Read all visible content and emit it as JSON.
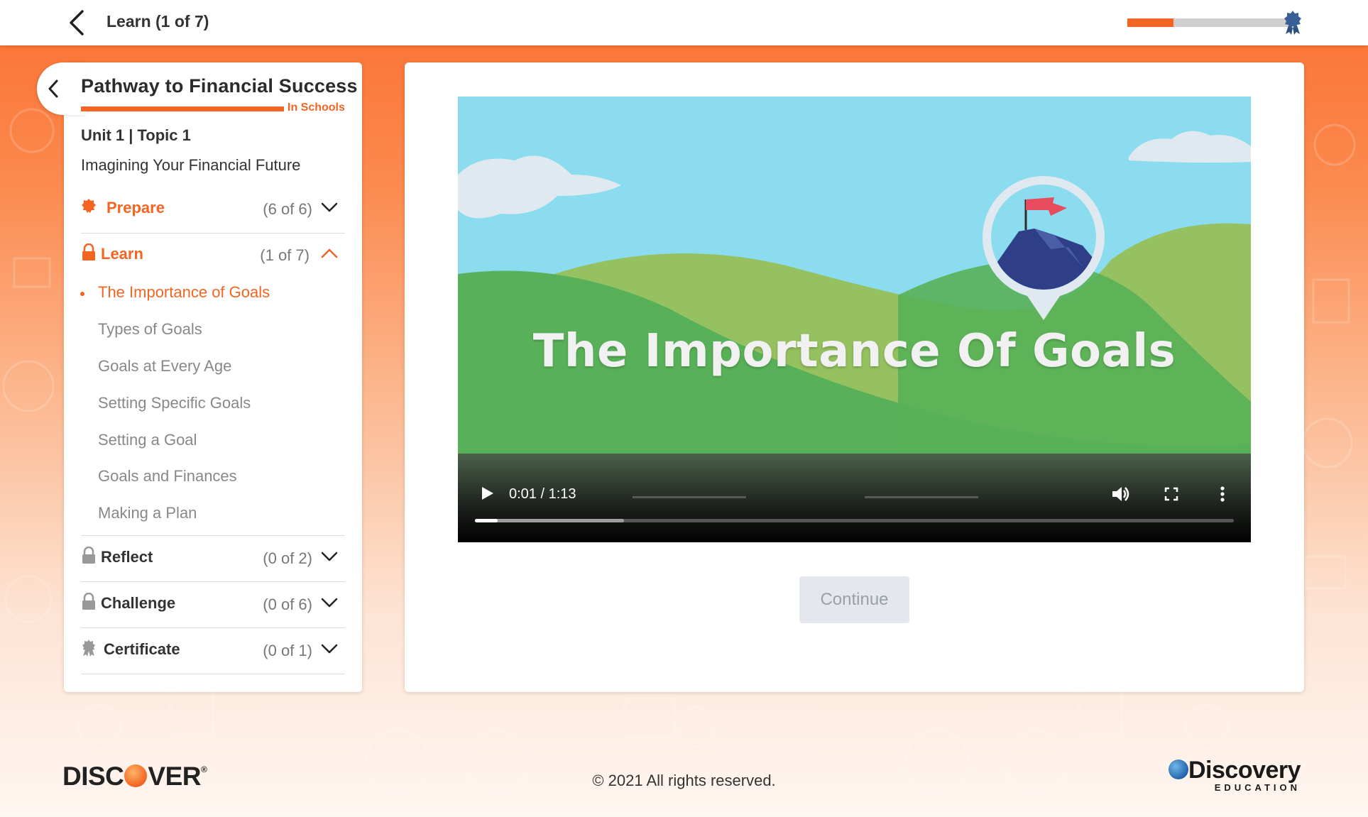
{
  "header": {
    "title": "Learn (1 of 7)",
    "progress_fraction": 0.28
  },
  "sidebar": {
    "course_title": "Pathway to Financial Success",
    "course_subtitle": "In Schools",
    "unit": "Unit 1 | Topic 1",
    "topic_title": "Imagining Your Financial Future",
    "sections": [
      {
        "label": "Prepare",
        "count": "(6 of 6)",
        "icon": "badge-icon",
        "state": "complete",
        "expanded": false
      },
      {
        "label": "Learn",
        "count": "(1 of 7)",
        "icon": "lock-icon",
        "state": "active",
        "expanded": true
      },
      {
        "label": "Reflect",
        "count": "(0 of 2)",
        "icon": "lock-icon",
        "state": "locked",
        "expanded": false
      },
      {
        "label": "Challenge",
        "count": "(0 of 6)",
        "icon": "lock-icon",
        "state": "locked",
        "expanded": false
      },
      {
        "label": "Certificate",
        "count": "(0 of 1)",
        "icon": "award-icon",
        "state": "locked",
        "expanded": false
      }
    ],
    "lessons": [
      "The Importance of Goals",
      "Types of Goals",
      "Goals at Every Age",
      "Setting Specific Goals",
      "Setting a Goal",
      "Goals and Finances",
      "Making a Plan"
    ],
    "active_lesson_index": 0
  },
  "video": {
    "title": "The Importance Of Goals",
    "time": "0:01 / 1:13",
    "played_fraction": 0.03
  },
  "main": {
    "continue_label": "Continue"
  },
  "footer": {
    "left_logo": "DISCOVER",
    "copyright": "© 2021 All rights reserved.",
    "right_logo": "Discovery",
    "right_logo_sub": "EDUCATION"
  },
  "colors": {
    "accent": "#f26522",
    "muted": "#888888",
    "background_top": "#fb7031"
  }
}
